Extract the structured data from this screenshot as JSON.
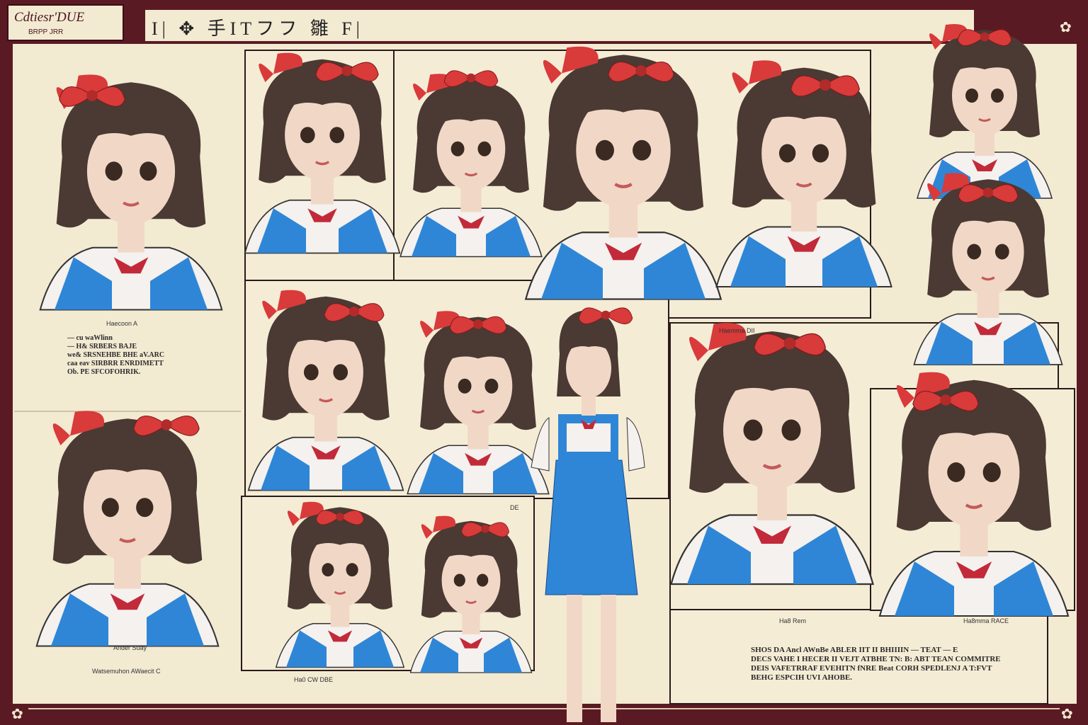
{
  "brand": {
    "title": "Cdtiesr'DUE",
    "subtitle": "BRPP JRR"
  },
  "header": {
    "text": "I| ✥ 手ITフフ 雛 F|"
  },
  "captions": {
    "c1": "Haecoon A",
    "c2": "Haemma DII",
    "c3": "Ander Suay",
    "c4": "Watsemuhon AWaecit C",
    "c5": "Ha0 CW DBE",
    "c6": "Ha8 Rem",
    "c7": "Ha8mma RACE",
    "c8": "DE"
  },
  "notes": {
    "left": "— cu waWlinn\n— H& SRBERS BAJE\nwe& SRSNEHBE BHE aV.ARC\ncaa eav SIRBRR ENRDIMETT\nOb. PE SFCOFOHRIK.",
    "bottom": "SHOS DA Ancl AWnBe ABLER IIT II BHIIIIN — TEAT — E\nDECS VAHE I HECER II VEJT ATBHE TN: B: ABT TEAN COMMITRE\nDEIS VAFETRRAF EVEHITN fNRE Beat CORH SPEDLENJ A T:FVT\nBEHG ESPCIH UVI AHOBE."
  },
  "colors": {
    "frame": "#5a1a24",
    "paper": "#f3ead2",
    "hair": "#4a3a33",
    "bow": "#d93a3a",
    "vest": "#2f86d6",
    "shirt": "#f4f1ee",
    "skin": "#f1d8c6"
  }
}
